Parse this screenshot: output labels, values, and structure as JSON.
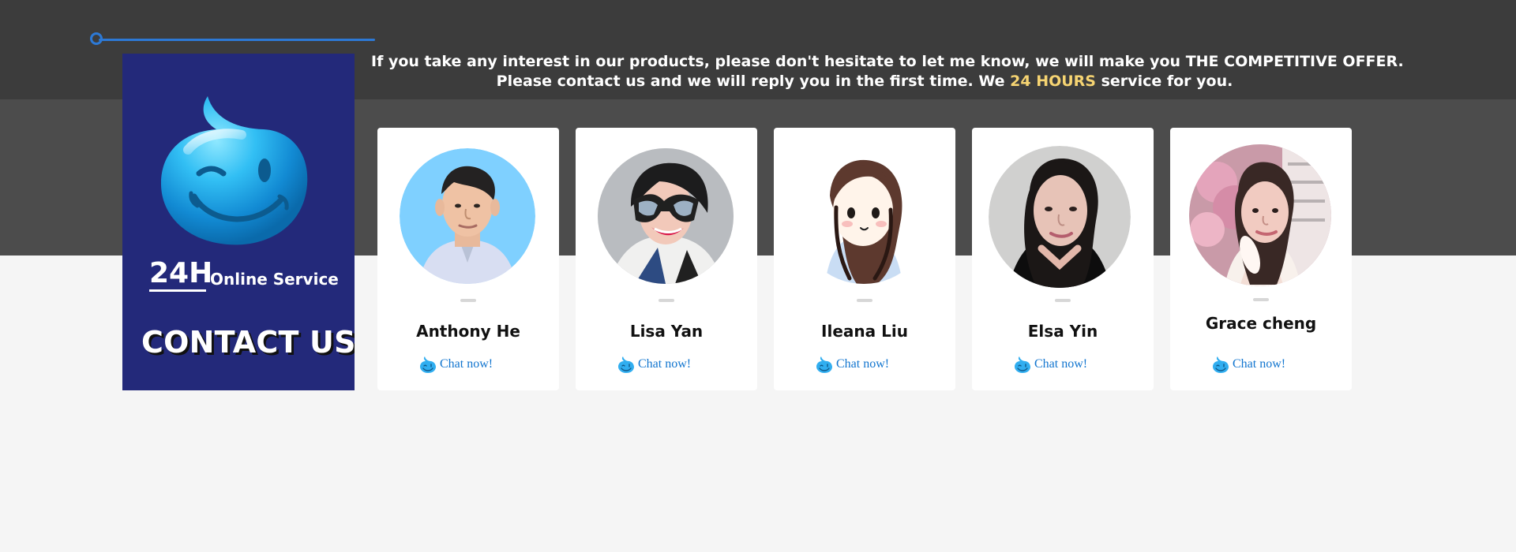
{
  "headline": {
    "line1": "If you take any interest in our products, please don't hesitate to let me know, we will make you THE COMPETITIVE OFFER.",
    "line2_prefix": "Please contact us and we will reply you in the first time. We ",
    "line2_highlight": "24 HOURS",
    "line2_suffix": " service for you."
  },
  "panel": {
    "hours": "24H",
    "online_service": "Online Service",
    "contact_us": "CONTACT US"
  },
  "cards": [
    {
      "name": "Anthony He",
      "chat_label": "Chat now!",
      "avatar_icon": "man-photo-avatar"
    },
    {
      "name": "Lisa Yan",
      "chat_label": "Chat now!",
      "avatar_icon": "woman-sunglasses-avatar"
    },
    {
      "name": "Ileana Liu",
      "chat_label": "Chat now!",
      "avatar_icon": "cartoon-girl-avatar"
    },
    {
      "name": "Elsa Yin",
      "chat_label": "Chat now!",
      "avatar_icon": "woman-portrait-avatar"
    },
    {
      "name": "Grace cheng",
      "chat_label": "Chat now!",
      "avatar_icon": "woman-pink-background-avatar"
    }
  ],
  "colors": {
    "top_band": "#3c3c3c",
    "middle_band": "#4c4c4c",
    "page_background": "#f5f5f5",
    "contact_panel": "#23297a",
    "accent_blue": "#2d79d5",
    "chat_blue": "#1175cf",
    "highlight_yellow": "#f6d472"
  },
  "icons": {
    "decorative_marker": "circle-line-marker-icon",
    "mascot": "winking-droplet-mascot-icon",
    "chat": "chat-droplet-icon"
  }
}
